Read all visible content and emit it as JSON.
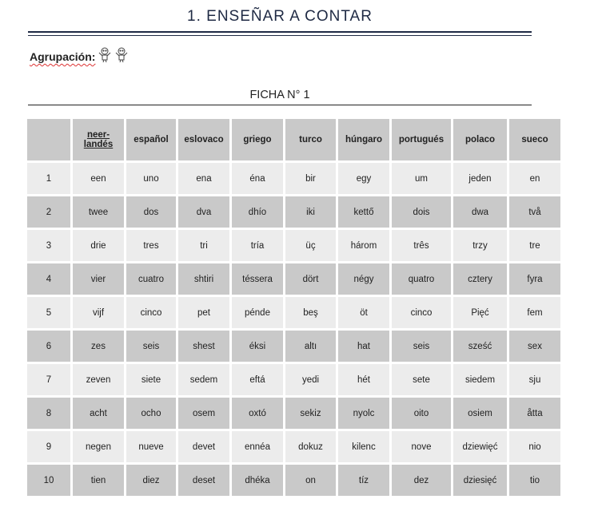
{
  "header": {
    "title": "1. ENSEÑAR A CONTAR",
    "grouping_label": "Agrupación:",
    "grouping_icon": "two-people-figures-icon",
    "sheet_title": "FICHA N° 1"
  },
  "table": {
    "columns": [
      "",
      "neer-landés",
      "español",
      "eslovaco",
      "griego",
      "turco",
      "húngaro",
      "portugués",
      "polaco",
      "sueco"
    ],
    "rows": [
      [
        "1",
        "een",
        "uno",
        "ena",
        "éna",
        "bir",
        "egy",
        "um",
        "jeden",
        "en"
      ],
      [
        "2",
        "twee",
        "dos",
        "dva",
        "dhío",
        "iki",
        "kettő",
        "dois",
        "dwa",
        "två"
      ],
      [
        "3",
        "drie",
        "tres",
        "tri",
        "tría",
        "üç",
        "három",
        "três",
        "trzy",
        "tre"
      ],
      [
        "4",
        "vier",
        "cuatro",
        "shtiri",
        "téssera",
        "dört",
        "négy",
        "quatro",
        "cztery",
        "fyra"
      ],
      [
        "5",
        "vijf",
        "cinco",
        "pet",
        "pénde",
        "beş",
        "öt",
        "cinco",
        "Pięć",
        "fem"
      ],
      [
        "6",
        "zes",
        "seis",
        "shest",
        "éksi",
        "altı",
        "hat",
        "seis",
        "sześć",
        "sex"
      ],
      [
        "7",
        "zeven",
        "siete",
        "sedem",
        "eftá",
        "yedi",
        "hét",
        "sete",
        "siedem",
        "sju"
      ],
      [
        "8",
        "acht",
        "ocho",
        "osem",
        "oxtó",
        "sekiz",
        "nyolc",
        "oito",
        "osiem",
        "åtta"
      ],
      [
        "9",
        "negen",
        "nueve",
        "devet",
        "ennéa",
        "dokuz",
        "kilenc",
        "nove",
        "dziewięć",
        "nio"
      ],
      [
        "10",
        "tien",
        "diez",
        "deset",
        "dhéka",
        "on",
        "tíz",
        "dez",
        "dziesięć",
        "tio"
      ]
    ]
  },
  "colors": {
    "title": "#1f2a44",
    "header_cell": "#c9c9c9",
    "row_light": "#ececec",
    "row_dark": "#c9c9c9"
  }
}
